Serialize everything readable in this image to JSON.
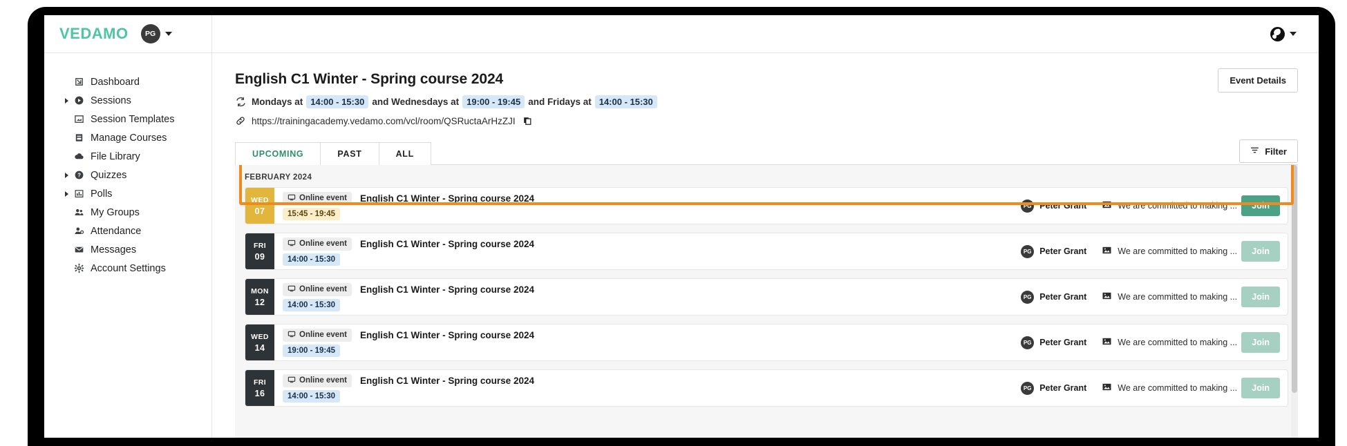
{
  "colors": {
    "brand_green": "#4ec5a5",
    "accent_green": "#4ba286",
    "accent_green_disabled": "#a6d1c2",
    "highlight_orange": "#f08a1d",
    "today_gold": "#e2b63c",
    "chip_dark": "#2e3338",
    "time_badge_blue": "#d6e7f7",
    "time_badge_warm": "#fbeec9",
    "tab_active_green": "#2f8f6b"
  },
  "topbar": {
    "brand": "VEDAMO",
    "avatar_initials": "PG",
    "avatar_caret": "chevron-down-icon",
    "language_icon": "globe-icon",
    "language_caret": "chevron-down-icon"
  },
  "sidebar": {
    "items": [
      {
        "label": "Dashboard",
        "icon": "dashboard-icon",
        "expandable": false
      },
      {
        "label": "Sessions",
        "icon": "play-circle-icon",
        "expandable": true
      },
      {
        "label": "Session Templates",
        "icon": "session-template-icon",
        "expandable": false
      },
      {
        "label": "Manage Courses",
        "icon": "book-icon",
        "expandable": false
      },
      {
        "label": "File Library",
        "icon": "cloud-upload-icon",
        "expandable": false
      },
      {
        "label": "Quizzes",
        "icon": "question-circle-icon",
        "expandable": true
      },
      {
        "label": "Polls",
        "icon": "bar-chart-icon",
        "expandable": true
      },
      {
        "label": "My Groups",
        "icon": "users-icon",
        "expandable": false
      },
      {
        "label": "Attendance",
        "icon": "user-check-icon",
        "expandable": false
      },
      {
        "label": "Messages",
        "icon": "envelope-icon",
        "expandable": false
      },
      {
        "label": "Account Settings",
        "icon": "gear-icon",
        "expandable": false
      }
    ]
  },
  "main": {
    "title": "English C1 Winter - Spring course 2024",
    "event_details_button": "Event Details",
    "schedule": {
      "icon": "recurrence-icon",
      "part1": "Mondays at",
      "time1": "14:00 - 15:30",
      "part2": "and Wednesdays at",
      "time2": "19:00 - 19:45",
      "part3": "and Fridays at",
      "time3": "14:00 - 15:30"
    },
    "url": {
      "icon": "link-icon",
      "value": "https://trainingacademy.vedamo.com/vcl/room/QSRuctaArHzZJI",
      "copy_icon": "copy-icon"
    },
    "tabs": [
      {
        "label": "UPCOMING",
        "active": true
      },
      {
        "label": "PAST",
        "active": false
      },
      {
        "label": "ALL",
        "active": false
      }
    ],
    "filter_button": {
      "label": "Filter",
      "icon": "filter-icon"
    },
    "month_label": "FEBRUARY 2024",
    "events": [
      {
        "weekday": "WED",
        "day": "07",
        "today": true,
        "badge": "Online event",
        "badge_icon": "monitor-icon",
        "title": "English C1 Winter - Spring course 2024",
        "time": "15:45 - 19:45",
        "time_style": "warm",
        "host_initials": "PG",
        "host": "Peter Grant",
        "note_icon": "image-icon",
        "note": "We are committed to making ...",
        "join_label": "Join",
        "join_enabled": true,
        "highlighted": true
      },
      {
        "weekday": "FRI",
        "day": "09",
        "today": false,
        "badge": "Online event",
        "badge_icon": "monitor-icon",
        "title": "English C1 Winter - Spring course 2024",
        "time": "14:00 - 15:30",
        "time_style": "blue",
        "host_initials": "PG",
        "host": "Peter Grant",
        "note_icon": "image-icon",
        "note": "We are committed to making ...",
        "join_label": "Join",
        "join_enabled": false,
        "highlighted": false
      },
      {
        "weekday": "MON",
        "day": "12",
        "today": false,
        "badge": "Online event",
        "badge_icon": "monitor-icon",
        "title": "English C1 Winter - Spring course 2024",
        "time": "14:00 - 15:30",
        "time_style": "blue",
        "host_initials": "PG",
        "host": "Peter Grant",
        "note_icon": "image-icon",
        "note": "We are committed to making ...",
        "join_label": "Join",
        "join_enabled": false,
        "highlighted": false
      },
      {
        "weekday": "WED",
        "day": "14",
        "today": false,
        "badge": "Online event",
        "badge_icon": "monitor-icon",
        "title": "English C1 Winter - Spring course 2024",
        "time": "19:00 - 19:45",
        "time_style": "blue",
        "host_initials": "PG",
        "host": "Peter Grant",
        "note_icon": "image-icon",
        "note": "We are committed to making ...",
        "join_label": "Join",
        "join_enabled": false,
        "highlighted": false
      },
      {
        "weekday": "FRI",
        "day": "16",
        "today": false,
        "badge": "Online event",
        "badge_icon": "monitor-icon",
        "title": "English C1 Winter - Spring course 2024",
        "time": "14:00 - 15:30",
        "time_style": "blue",
        "host_initials": "PG",
        "host": "Peter Grant",
        "note_icon": "image-icon",
        "note": "We are committed to making ...",
        "join_label": "Join",
        "join_enabled": false,
        "highlighted": false
      }
    ]
  }
}
